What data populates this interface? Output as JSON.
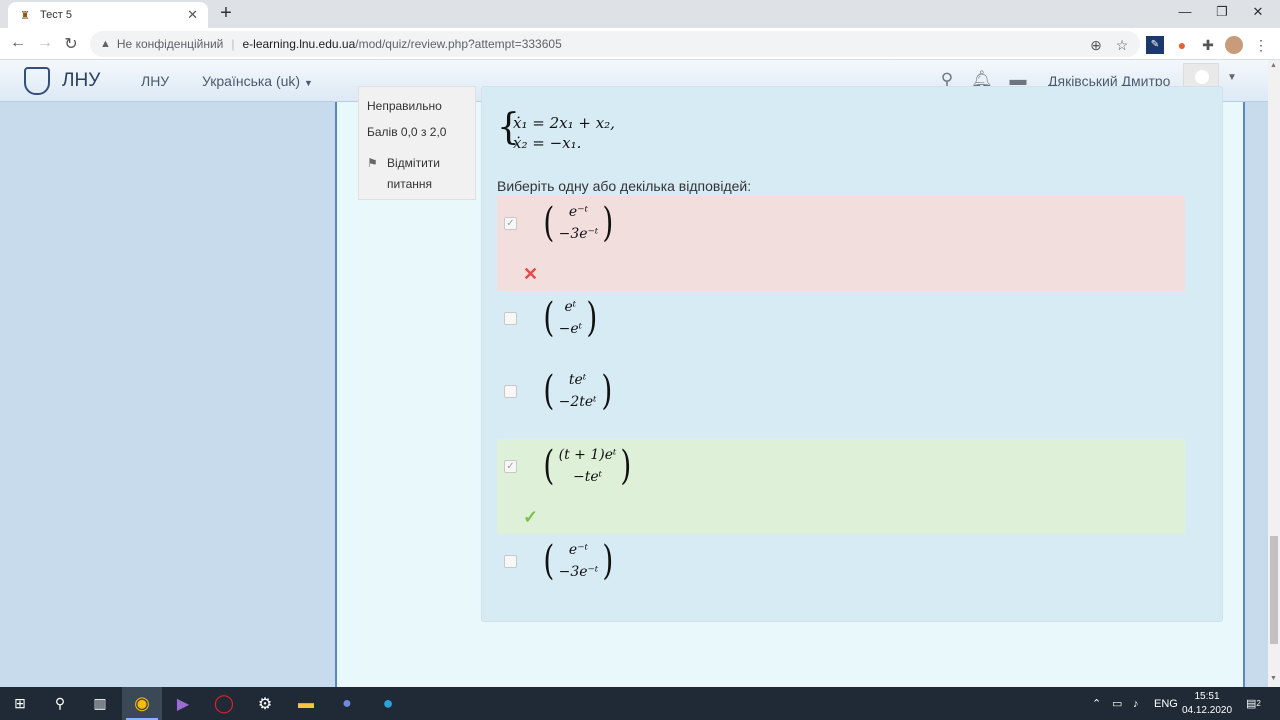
{
  "browser": {
    "tab_title": "Тест 5",
    "tab_close": "✕",
    "new_tab": "+",
    "window_controls": [
      "—",
      "❐",
      "✕"
    ],
    "security_label": "Не конфіденційний",
    "url_host": "e-learning.lnu.edu.ua",
    "url_path": "/mod/quiz/review.php?attempt=333605"
  },
  "header": {
    "site_name": "ЛНУ",
    "nav_items": [
      "ЛНУ",
      "Українська (uk)"
    ],
    "user_name": "Дяківський Дмитро"
  },
  "question_info": {
    "state": "Неправильно",
    "grade": "Балів 0,0 з 2,0",
    "flag_line1": "Відмітити",
    "flag_line2": "питання"
  },
  "question": {
    "eq1": "ẋ₁ = 2x₁ + x₂,",
    "eq2": "ẋ₂ = −x₁.",
    "prompt": "Виберіть одну або декілька відповідей:",
    "answers": [
      {
        "top": "e⁻ᵗ",
        "bottom": "−3e⁻ᵗ",
        "checked": true,
        "status": "incorrect"
      },
      {
        "top": "eᵗ",
        "bottom": "−eᵗ",
        "checked": false,
        "status": "none"
      },
      {
        "top": "teᵗ",
        "bottom": "−2teᵗ",
        "checked": false,
        "status": "none"
      },
      {
        "top": "(t + 1)eᵗ",
        "bottom": "−teᵗ",
        "checked": true,
        "status": "correct"
      },
      {
        "top": "e⁻ᵗ",
        "bottom": "−3e⁻ᵗ",
        "checked": false,
        "status": "none"
      }
    ],
    "incorrect_mark": "✕",
    "correct_mark": "✓"
  },
  "taskbar": {
    "lang": "ENG",
    "time": "15:51",
    "date": "04.12.2020",
    "notif_count": "2"
  }
}
